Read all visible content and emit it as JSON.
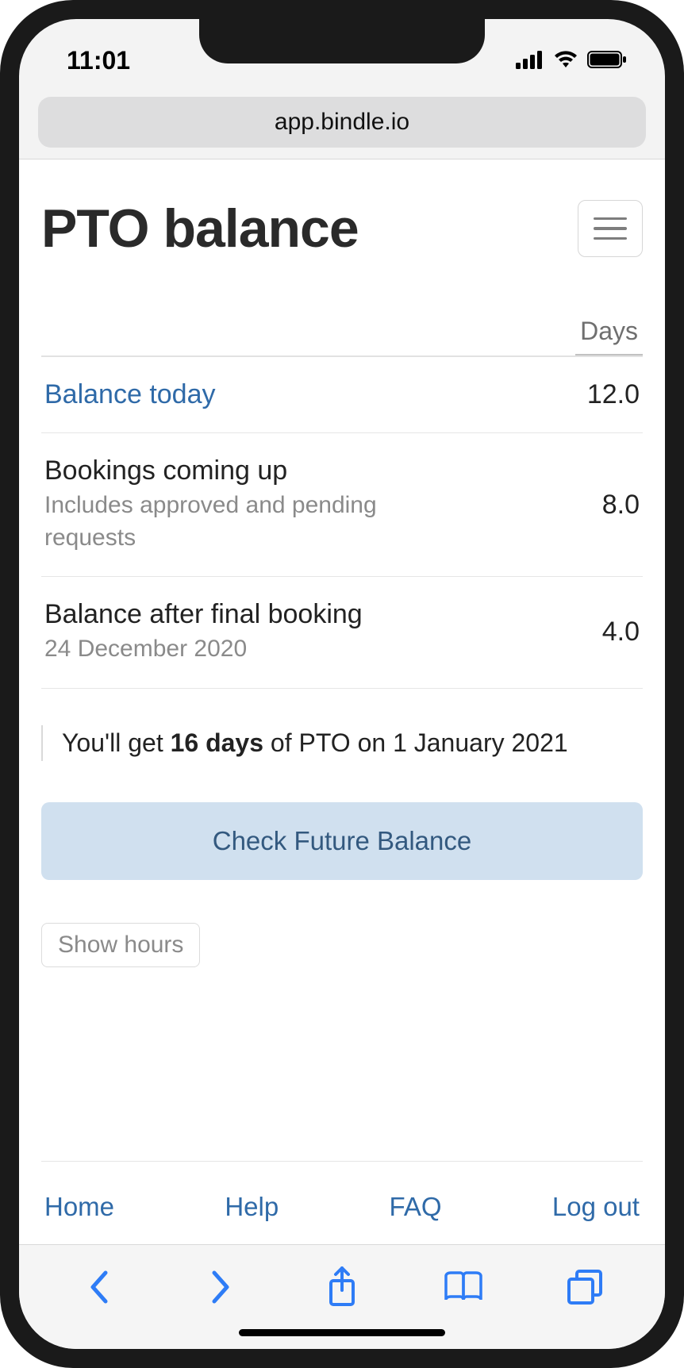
{
  "status": {
    "time": "11:01"
  },
  "browser": {
    "url": "app.bindle.io"
  },
  "header": {
    "title": "PTO balance"
  },
  "table": {
    "column_label": "Days",
    "rows": [
      {
        "title": "Balance today",
        "subtitle": "",
        "value": "12.0",
        "is_link": true
      },
      {
        "title": "Bookings coming up",
        "subtitle": "Includes approved and pending requests",
        "value": "8.0",
        "is_link": false
      },
      {
        "title": "Balance after final booking",
        "subtitle": "24 December 2020",
        "value": "4.0",
        "is_link": false
      }
    ]
  },
  "accrual": {
    "prefix": "You'll get ",
    "amount": "16 days",
    "suffix": " of PTO on 1 January 2021"
  },
  "buttons": {
    "check_future": "Check Future Balance",
    "show_hours": "Show hours"
  },
  "footer": {
    "home": "Home",
    "help": "Help",
    "faq": "FAQ",
    "logout": "Log out"
  }
}
